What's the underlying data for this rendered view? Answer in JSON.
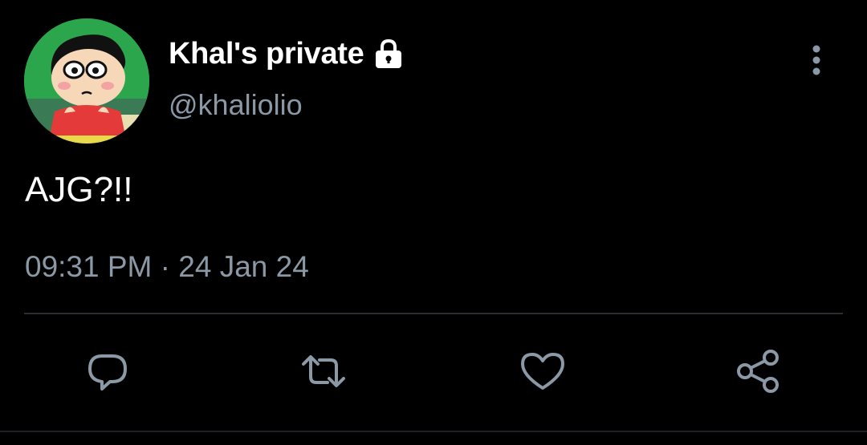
{
  "tweet": {
    "display_name": "Khal's private",
    "handle": "@khaliolio",
    "text": "AJG?!!",
    "time": "09:31 PM",
    "separator": "·",
    "date": "24 Jan 24"
  },
  "icons": {
    "protected": "lock-icon",
    "more": "more-vertical-icon",
    "reply": "reply-icon",
    "retweet": "retweet-icon",
    "like": "heart-icon",
    "share": "share-icon"
  },
  "colors": {
    "background": "#000000",
    "primary_text": "#ffffff",
    "secondary_text": "#8b98a5",
    "divider": "#2a2e33"
  }
}
